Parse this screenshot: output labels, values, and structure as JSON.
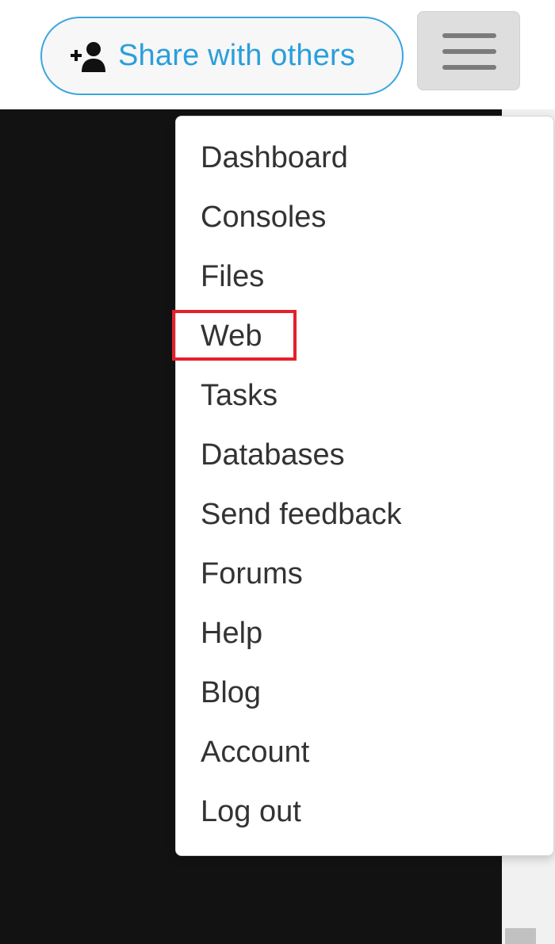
{
  "header": {
    "share_button_label": "Share with others",
    "share_icon": "add-user-icon",
    "menu_icon": "hamburger-menu-icon"
  },
  "dropdown": {
    "items": [
      {
        "label": "Dashboard"
      },
      {
        "label": "Consoles"
      },
      {
        "label": "Files"
      },
      {
        "label": "Web"
      },
      {
        "label": "Tasks"
      },
      {
        "label": "Databases"
      },
      {
        "label": "Send feedback"
      },
      {
        "label": "Forums"
      },
      {
        "label": "Help"
      },
      {
        "label": "Blog"
      },
      {
        "label": "Account"
      },
      {
        "label": "Log out"
      }
    ],
    "highlighted_item": "Web"
  },
  "colors": {
    "accent": "#2a9fdc",
    "share_border": "#3aa6e0",
    "highlight": "#e3202b",
    "console_background": "#121212",
    "menu_text": "#333333"
  }
}
